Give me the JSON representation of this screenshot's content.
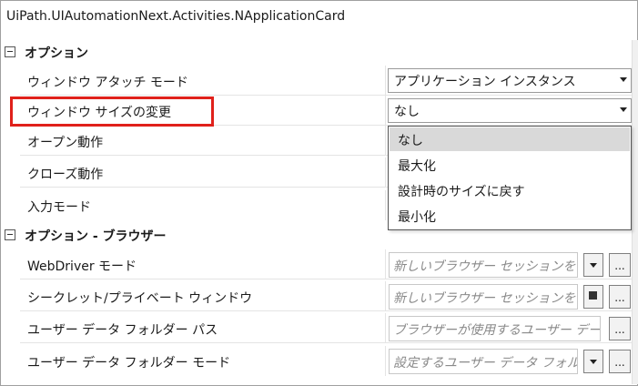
{
  "window": {
    "title": "UiPath.UIAutomationNext.Activities.NApplicationCard"
  },
  "categories": [
    {
      "label": "オプション"
    },
    {
      "label": "オプション - ブラウザー"
    }
  ],
  "options": {
    "window_attach_mode": {
      "label": "ウィンドウ アタッチ モード",
      "value": "アプリケーション インスタンス"
    },
    "window_resize": {
      "label": "ウィンドウ サイズの変更",
      "value": "なし"
    },
    "open_behavior": {
      "label": "オープン動作"
    },
    "close_behavior": {
      "label": "クローズ動作"
    },
    "input_mode": {
      "label": "入力モード"
    }
  },
  "dropdown": {
    "items": [
      "なし",
      "最大化",
      "設計時のサイズに戻す",
      "最小化"
    ],
    "selected_index": 0
  },
  "browser": {
    "webdriver_mode": {
      "label": "WebDriver モード",
      "placeholder": "新しいブラウザー セッションを"
    },
    "incognito": {
      "label": "シークレット/プライベート ウィンドウ",
      "placeholder": "新しいブラウザー セッションを"
    },
    "user_data_folder_path": {
      "label": "ユーザー データ フォルダー パス",
      "placeholder": "ブラウザーが使用するユーザー デー"
    },
    "user_data_folder_mode": {
      "label": "ユーザー データ フォルダー モード",
      "placeholder": "設定するユーザー データ フォル"
    }
  },
  "button_ellipsis": "..."
}
